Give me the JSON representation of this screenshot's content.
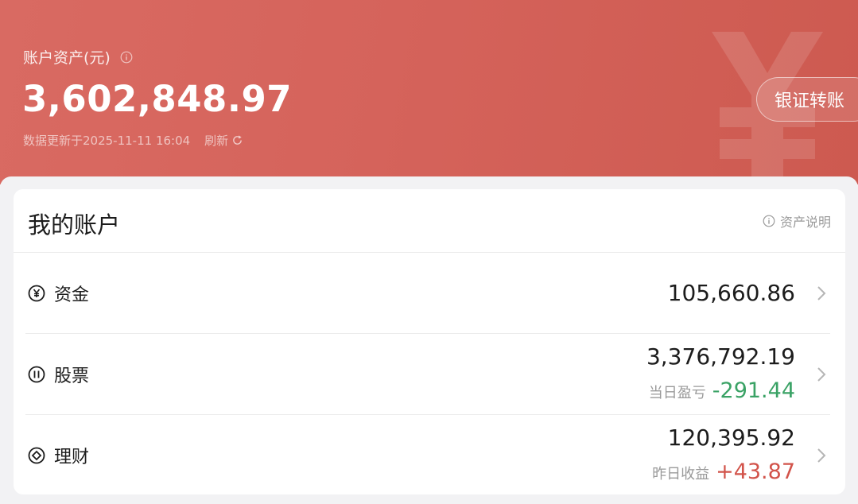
{
  "header": {
    "asset_label": "账户资产(元)",
    "total_assets": "3,602,848.97",
    "update_text": "数据更新于2025-11-11 16:04",
    "refresh_label": "刷新",
    "transfer_button": "银证转账",
    "watermark_glyph": "currency-yen-icon",
    "accent_color": "#d5635b"
  },
  "account": {
    "title": "我的账户",
    "asset_note": "资产说明",
    "rows": [
      {
        "label": "资金",
        "value": "105,660.86",
        "icon": "yen-circle-icon"
      },
      {
        "label": "股票",
        "value": "3,376,792.19",
        "sub_label": "当日盈亏",
        "sub_value": "-291.44",
        "sub_color": "#3aa265",
        "icon": "stock-circle-icon"
      },
      {
        "label": "理财",
        "value": "120,395.92",
        "sub_label": "昨日收益",
        "sub_value": "+43.87",
        "sub_color": "#d2534a",
        "icon": "diamond-circle-icon"
      }
    ]
  }
}
